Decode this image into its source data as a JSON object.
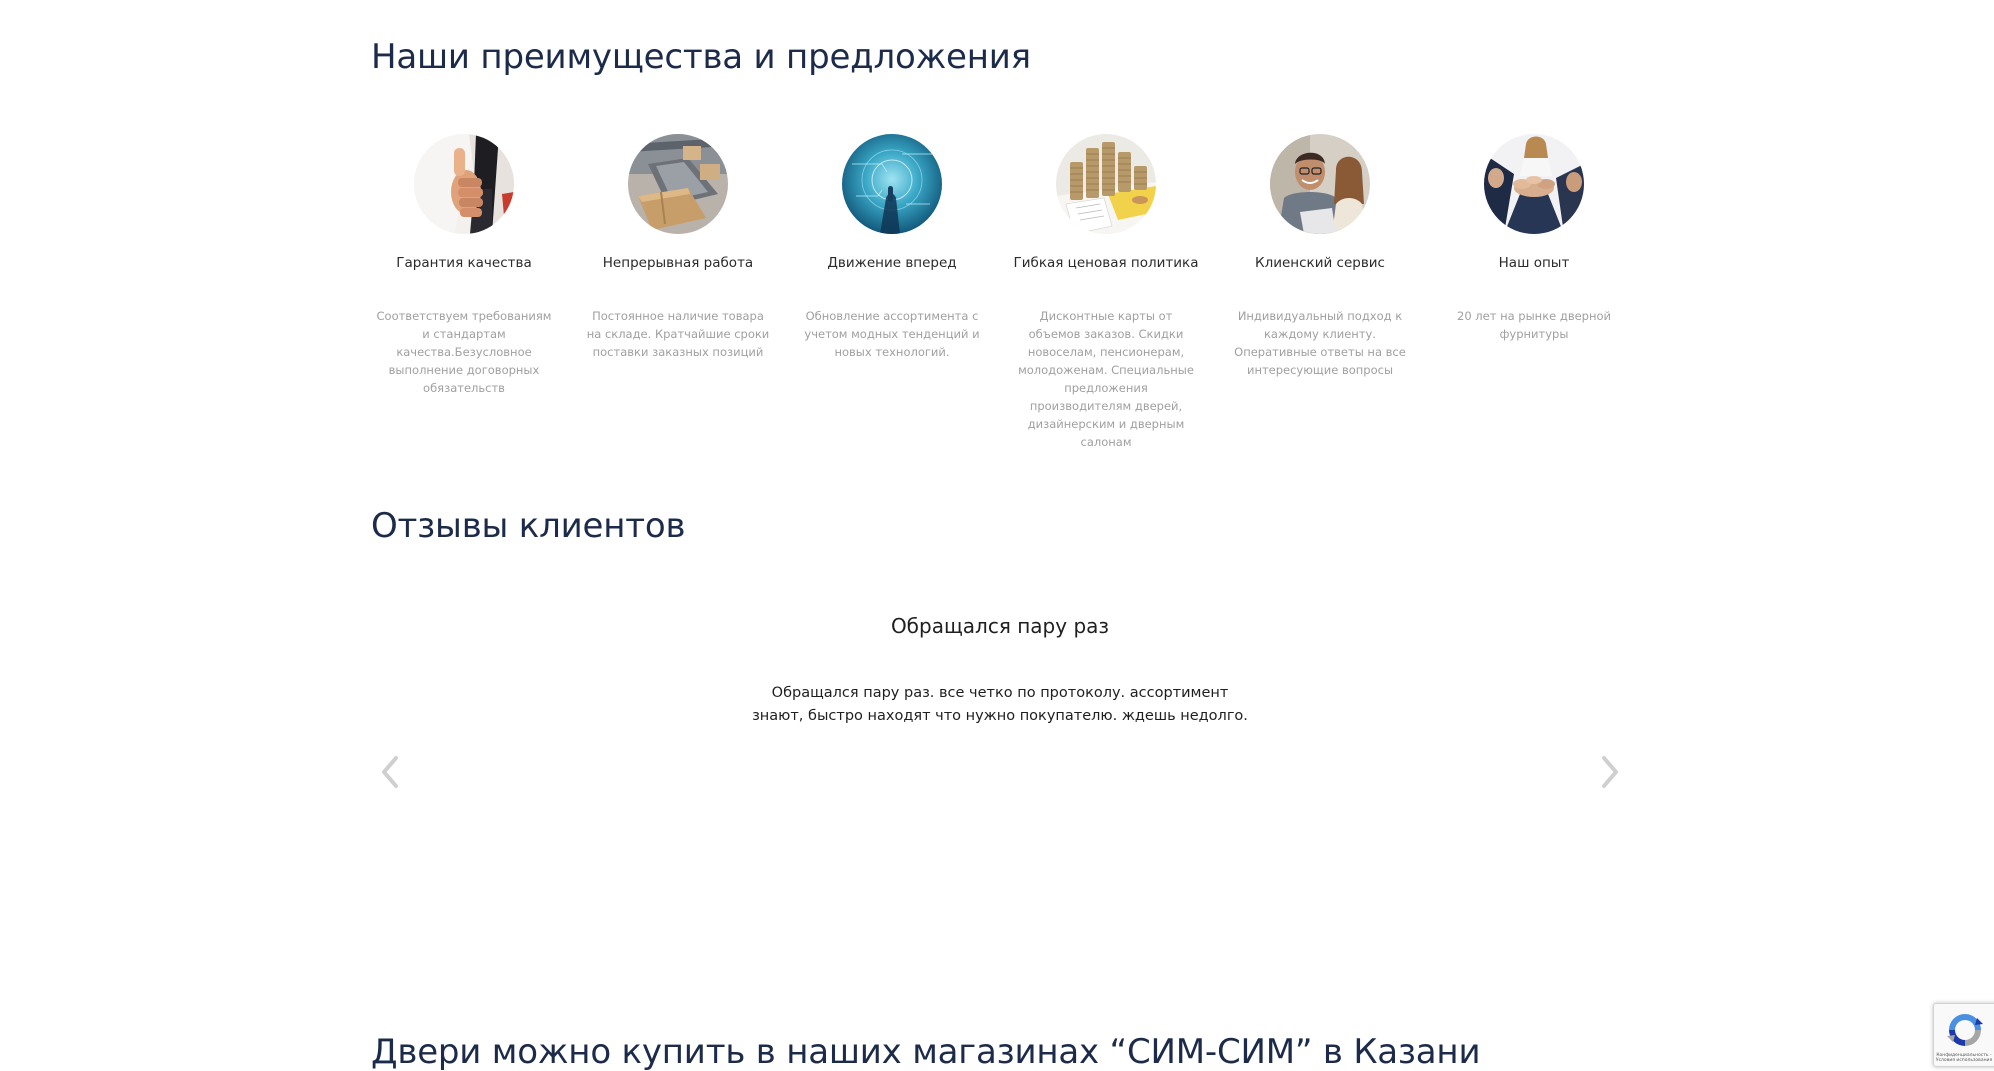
{
  "sections": {
    "advantages_title": "Наши преимущества и предложения",
    "reviews_title": "Отзывы клиентов",
    "stores_title": "Двери можно купить в наших магазинах “СИМ-СИМ” в Казани"
  },
  "features": [
    {
      "icon": "thumbs-up-photo-icon",
      "title": "Гарантия качества",
      "desc": "Соответствуем требованиям и стандартам качества.Безусловное выполнение договорных обязательств"
    },
    {
      "icon": "warehouse-boxes-photo-icon",
      "title": "Непрерывная работа",
      "desc": "Постоянное наличие товара  на складе. Кратчайшие сроки поставки заказных позиций"
    },
    {
      "icon": "technology-touch-photo-icon",
      "title": "Движение вперед",
      "desc": "Обновление  ассортимента с учетом модных тенденций и новых технологий."
    },
    {
      "icon": "coins-stacks-photo-icon",
      "title": "Гибкая ценовая политика",
      "desc": "Дисконтные карты от объемов заказов. Скидки новоселам, пенсионерам, молодоженам. Специальные предложения  производителям дверей, дизайнерским и дверным салонам"
    },
    {
      "icon": "customer-service-photo-icon",
      "title": "Клиенский сервис",
      "desc": "Индивидуальный подход к каждому клиенту. Оперативные ответы на все интересующие вопросы"
    },
    {
      "icon": "team-hands-photo-icon",
      "title": "Наш опыт",
      "desc": "20 лет на рынке дверной фурнитуры"
    }
  ],
  "review": {
    "title": "Обращался пару раз",
    "text": "Обращался пару раз. все четко по протоколу. ассортимент знают, быстро находят что нужно покупателю. ждешь недолго.",
    "prev_icon": "chevron-left-icon",
    "next_icon": "chevron-right-icon"
  },
  "recaptcha": {
    "caption": "Конфиденциальность - Условия использования",
    "icon": "recaptcha-logo-icon"
  },
  "colors": {
    "heading": "#1d2b4a",
    "feature_desc": "#a0a0a0",
    "text": "#1f1f1f",
    "arrow": "#cfcfcf"
  }
}
